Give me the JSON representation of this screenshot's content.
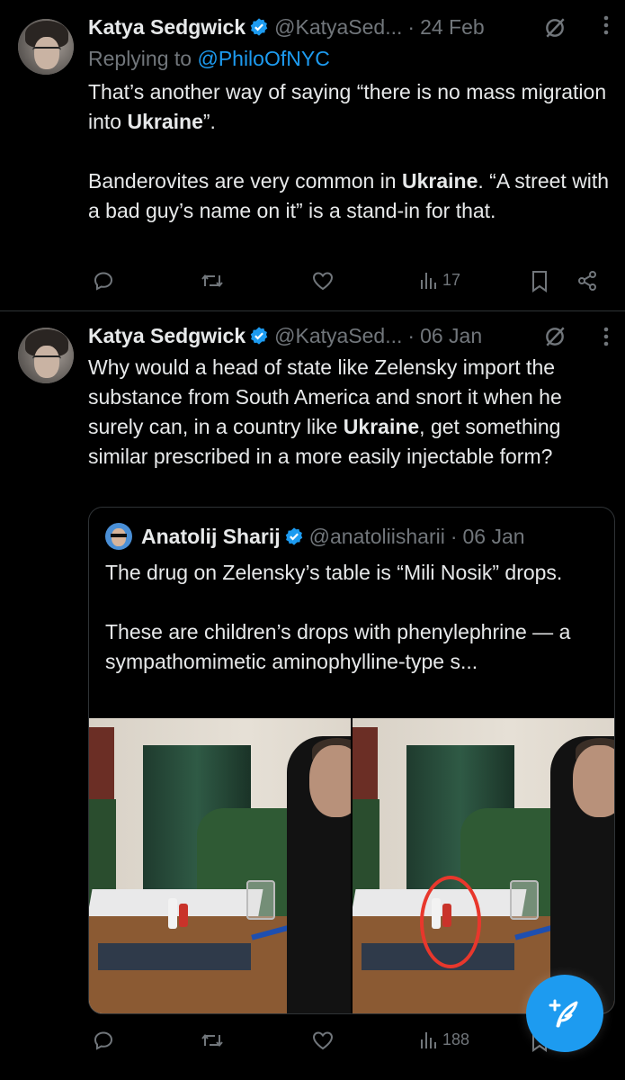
{
  "colors": {
    "accent": "#1d9bf0",
    "muted": "#71767b",
    "text": "#e7e9ea",
    "background": "#000000",
    "annotation": "#e8372c"
  },
  "tweets": [
    {
      "name": "Katya Sedgwick",
      "handle": "@KatyaSed...",
      "date": "24 Feb",
      "dot": "·",
      "replying_prefix": "Replying to ",
      "replying_to": "@PhiloOfNYC",
      "views": "17",
      "body_parts": [
        "That’s another way of saying “there is no mass migration into ",
        "Ukraine",
        "”.\n\nBanderovites are very common in ",
        "Ukraine",
        ". “A street with a bad guy’s name on it” is a stand-in for that."
      ]
    },
    {
      "name": "Katya Sedgwick",
      "handle": "@KatyaSed...",
      "date": "06 Jan",
      "dot": "·",
      "views": "188",
      "body_parts": [
        "Why would a head of state like Zelensky import the substance from South America and snort it when he surely can, in a country like ",
        "Ukraine",
        ", get something similar prescribed in a more easily injectable form?"
      ],
      "quote": {
        "name": "Anatolij Sharij",
        "handle": "@anatoliisharii",
        "dot": "·",
        "date": "06 Jan",
        "text": "The drug on Zelensky’s table is “Mili Nosik” drops.\n\nThese are children’s drops with phenylephrine — a sympathomimetic aminophylline-type s..."
      }
    }
  ],
  "icons": {
    "reply": "reply-icon",
    "retweet": "retweet-icon",
    "like": "heart-icon",
    "views": "views-icon",
    "bookmark": "bookmark-icon",
    "share": "share-icon",
    "grok": "grok-icon",
    "more": "more-icon",
    "compose": "compose-icon"
  }
}
